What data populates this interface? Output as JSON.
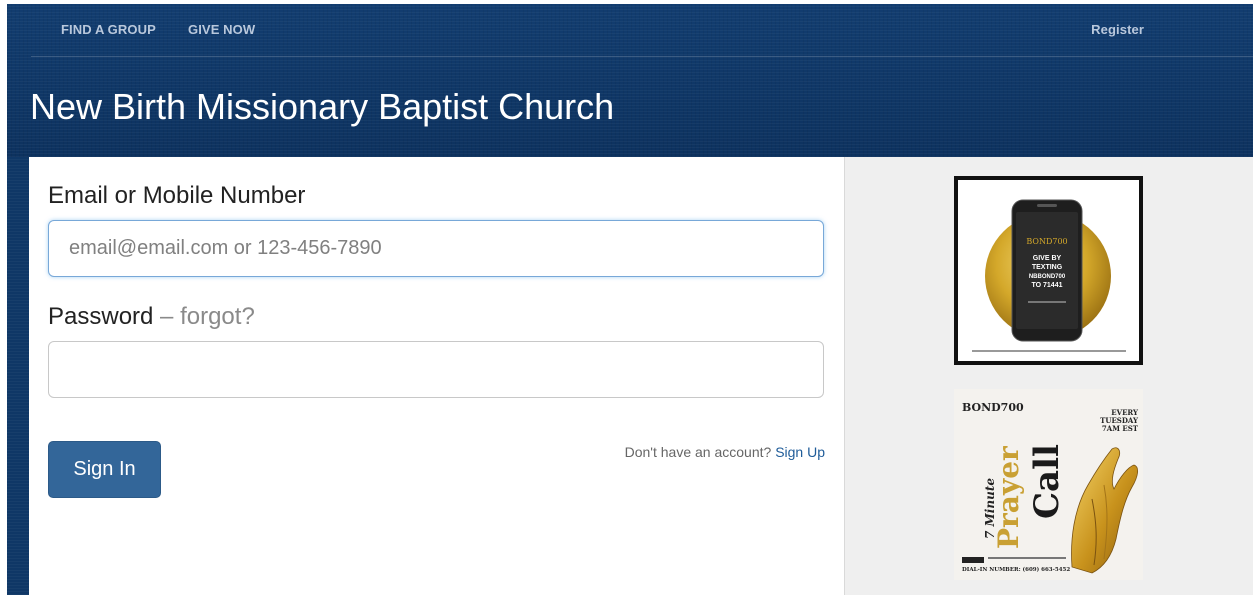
{
  "nav": {
    "find_group": "FIND A GROUP",
    "give_now": "GIVE NOW",
    "register": "Register"
  },
  "header": {
    "title": "New Birth Missionary Baptist Church"
  },
  "form": {
    "email_label": "Email or Mobile Number",
    "email_placeholder": "email@email.com or 123-456-7890",
    "email_value": "",
    "password_label": "Password",
    "password_dash": "–",
    "forgot_label": "forgot?",
    "password_value": "",
    "signin_label": "Sign In",
    "no_account_text": "Don't have an account?",
    "signup_label": "Sign Up"
  },
  "promos": {
    "promo1": {
      "brand": "BOND700",
      "line1": "GIVE BY",
      "line2": "TEXTING",
      "line3": "NBBOND700",
      "line4": "TO 71441"
    },
    "promo2": {
      "brand": "BOND700",
      "schedule1": "EVERY",
      "schedule2": "TUESDAY",
      "schedule3": "7AM EST",
      "word1": "7 Minute",
      "word2": "Prayer",
      "word3": "Call",
      "dial": "DIAL-IN NUMBER: (609) 663-5452"
    }
  },
  "colors": {
    "header_bg": "#0f3766",
    "button_bg": "#336699",
    "link": "#1f5c99",
    "gold": "#d4a82a"
  }
}
